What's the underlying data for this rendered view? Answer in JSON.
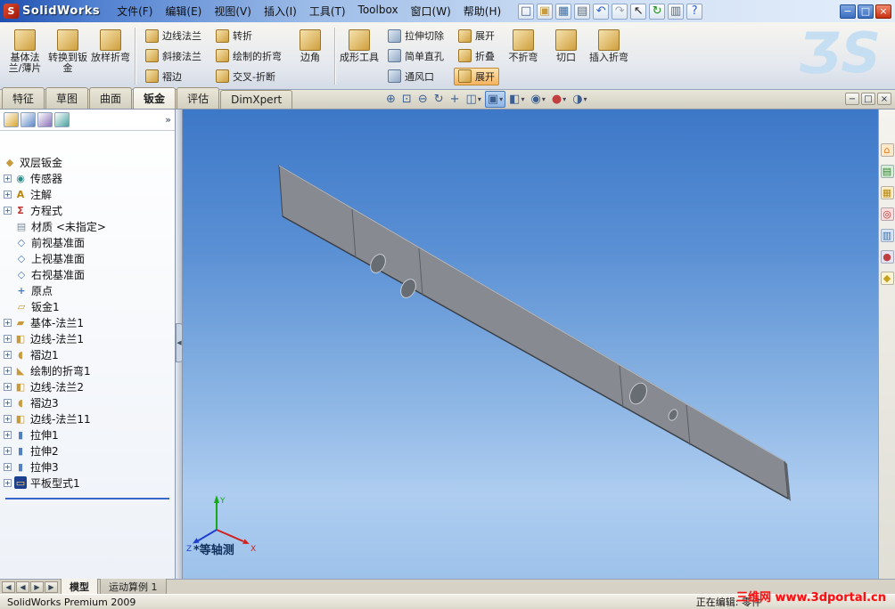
{
  "titlebar": {
    "app_name": "SolidWorks",
    "window_buttons": [
      "minimize",
      "maximize",
      "close"
    ]
  },
  "menu": {
    "items": [
      "文件(F)",
      "编辑(E)",
      "视图(V)",
      "插入(I)",
      "工具(T)",
      "Toolbox",
      "窗口(W)",
      "帮助(H)"
    ]
  },
  "quick_toolbar": {
    "icons": [
      "new-document",
      "open",
      "save",
      "print",
      "undo",
      "redo",
      "select",
      "rebuild",
      "file-properties",
      "help"
    ]
  },
  "ribbon": {
    "cells": [
      {
        "type": "large",
        "name": "base-flange",
        "label": "基体法兰/薄片",
        "tone": "gold"
      },
      {
        "type": "large",
        "name": "convert-to-sheet-metal",
        "label": "转换到钣金",
        "tone": "gold"
      },
      {
        "type": "large",
        "name": "lofted-bend",
        "label": "放样折弯",
        "tone": "gold"
      },
      {
        "type": "sep"
      },
      {
        "type": "stack",
        "items": [
          {
            "name": "edge-flange",
            "label": "边线法兰",
            "tone": "gold"
          },
          {
            "name": "miter-flange",
            "label": "斜接法兰",
            "tone": "gold"
          },
          {
            "name": "hem",
            "label": "褶边",
            "tone": "gold"
          }
        ]
      },
      {
        "type": "stack",
        "items": [
          {
            "name": "jog",
            "label": "转折",
            "tone": "gold"
          },
          {
            "name": "sketched-bend",
            "label": "绘制的折弯",
            "tone": "gold"
          },
          {
            "name": "cross-break",
            "label": "交叉-折断",
            "tone": "gold"
          }
        ]
      },
      {
        "type": "large",
        "name": "corner",
        "label": "边角",
        "tone": "gold"
      },
      {
        "type": "sep"
      },
      {
        "type": "large",
        "name": "forming-tool",
        "label": "成形工具",
        "tone": "gold"
      },
      {
        "type": "stack",
        "items": [
          {
            "name": "extruded-cut",
            "label": "拉伸切除",
            "tone": "steel"
          },
          {
            "name": "simple-hole",
            "label": "简单直孔",
            "tone": "steel"
          },
          {
            "name": "vent",
            "label": "通风口",
            "tone": "steel"
          }
        ]
      },
      {
        "type": "stack",
        "items": [
          {
            "name": "unfold",
            "label": "展开",
            "tone": "gold"
          },
          {
            "name": "fold",
            "label": "折叠",
            "tone": "gold"
          },
          {
            "name": "flatten",
            "label": "展开",
            "tone": "gold",
            "selected": true
          }
        ]
      },
      {
        "type": "large",
        "name": "no-bends",
        "label": "不折弯",
        "tone": "gold"
      },
      {
        "type": "large",
        "name": "rip",
        "label": "切口",
        "tone": "gold"
      },
      {
        "type": "large",
        "name": "insert-bends",
        "label": "插入折弯",
        "tone": "gold"
      }
    ]
  },
  "command_tabs": {
    "tabs": [
      {
        "name": "features",
        "label": "特征"
      },
      {
        "name": "sketch",
        "label": "草图"
      },
      {
        "name": "surfaces",
        "label": "曲面"
      },
      {
        "name": "sheet-metal",
        "label": "钣金",
        "active": true
      },
      {
        "name": "evaluate",
        "label": "评估"
      },
      {
        "name": "dimxpert",
        "label": "DimXpert"
      }
    ]
  },
  "document_window": {
    "buttons": [
      "minimize",
      "restore",
      "close"
    ]
  },
  "headsup": {
    "icons": [
      {
        "name": "zoom-to-fit"
      },
      {
        "name": "zoom-to-area"
      },
      {
        "name": "zoom-in-out"
      },
      {
        "name": "rotate-view"
      },
      {
        "name": "pan"
      },
      {
        "name": "section-view",
        "caret": true
      },
      {
        "name": "view-orientation",
        "caret": true,
        "active": true
      },
      {
        "name": "display-style",
        "caret": true
      },
      {
        "name": "hide-show-items",
        "caret": true
      },
      {
        "name": "appearances",
        "caret": true
      },
      {
        "name": "scene",
        "caret": true
      }
    ]
  },
  "panel": {
    "tabs": [
      "featuremanager",
      "propertymanager",
      "configurationmanager",
      "dimxpertmanager"
    ],
    "overflow": "»"
  },
  "feature_tree": {
    "items": [
      {
        "label": "双层钣金",
        "icon": "part",
        "root": true
      },
      {
        "label": "传感器",
        "icon": "sensors",
        "expand": true
      },
      {
        "label": "注解",
        "icon": "annotations",
        "expand": true
      },
      {
        "label": "方程式",
        "icon": "equations",
        "expand": true
      },
      {
        "label": "材质 <未指定>",
        "icon": "material"
      },
      {
        "label": "前视基准面",
        "icon": "plane"
      },
      {
        "label": "上视基准面",
        "icon": "plane"
      },
      {
        "label": "右视基准面",
        "icon": "plane"
      },
      {
        "label": "原点",
        "icon": "origin"
      },
      {
        "label": "钣金1",
        "icon": "sheet-metal"
      },
      {
        "label": "基体-法兰1",
        "icon": "base-flange",
        "expand": true
      },
      {
        "label": "边线-法兰1",
        "icon": "edge-flange",
        "expand": true
      },
      {
        "label": "褶边1",
        "icon": "hem",
        "expand": true
      },
      {
        "label": "绘制的折弯1",
        "icon": "sketched-bend",
        "expand": true
      },
      {
        "label": "边线-法兰2",
        "icon": "edge-flange",
        "expand": true
      },
      {
        "label": "褶边3",
        "icon": "hem",
        "expand": true
      },
      {
        "label": "边线-法兰11",
        "icon": "edge-flange",
        "expand": true
      },
      {
        "label": "拉伸1",
        "icon": "extrude",
        "expand": true
      },
      {
        "label": "拉伸2",
        "icon": "extrude",
        "expand": true
      },
      {
        "label": "拉伸3",
        "icon": "extrude",
        "expand": true
      },
      {
        "label": "平板型式1",
        "icon": "flat-pattern",
        "expand": true,
        "selected": true
      }
    ]
  },
  "viewport": {
    "view_label": "*等轴测",
    "triad": {
      "x": "X",
      "y": "Y",
      "z": "Z"
    }
  },
  "task_pane": {
    "icons": [
      "solidworks-resources",
      "design-library",
      "file-explorer",
      "search",
      "view-palette",
      "appearances-scenes",
      "custom-properties"
    ]
  },
  "bottom_tabs": {
    "nav": [
      "first",
      "previous",
      "next",
      "last"
    ],
    "tabs": [
      {
        "name": "model",
        "label": "模型",
        "active": true
      },
      {
        "name": "motion-study",
        "label": "运动算例 1"
      }
    ]
  },
  "status_bar": {
    "left": "SolidWorks Premium 2009",
    "right": "正在编辑: 零件",
    "watermark": "三维网 www.3dportal.cn"
  }
}
